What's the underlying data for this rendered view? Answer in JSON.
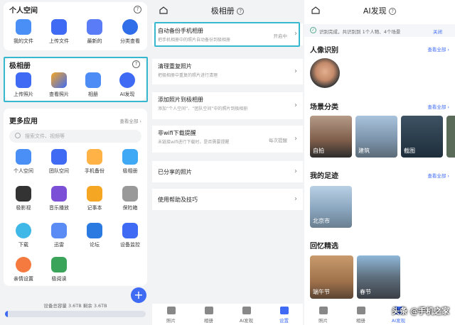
{
  "personal": {
    "title": "个人空间",
    "items": [
      {
        "label": "我的文件",
        "icon": "folder-icon"
      },
      {
        "label": "上传文件",
        "icon": "upload-icon"
      },
      {
        "label": "最新的",
        "icon": "recent-icon"
      },
      {
        "label": "分类查看",
        "icon": "category-icon"
      }
    ]
  },
  "album": {
    "title": "极相册",
    "items": [
      {
        "label": "上传照片",
        "icon": "upload-photo-icon"
      },
      {
        "label": "查看照片",
        "icon": "view-photo-icon"
      },
      {
        "label": "相册",
        "icon": "album-icon"
      },
      {
        "label": "AI发现",
        "icon": "ai-icon"
      }
    ]
  },
  "more": {
    "title": "更多应用",
    "view_all": "查看全部 ›",
    "search_placeholder": "搜索文件、视频等",
    "items": [
      {
        "label": "个人空间",
        "icon": "personal-space-icon"
      },
      {
        "label": "团队空间",
        "icon": "team-space-icon"
      },
      {
        "label": "手机备份",
        "icon": "phone-backup-icon"
      },
      {
        "label": "极相册",
        "icon": "photo-album-icon"
      },
      {
        "label": "极影视",
        "icon": "video-icon"
      },
      {
        "label": "音乐播放",
        "icon": "music-icon"
      },
      {
        "label": "记事本",
        "icon": "notepad-icon"
      },
      {
        "label": "保险箱",
        "icon": "safe-icon"
      },
      {
        "label": "下载",
        "icon": "download-icon"
      },
      {
        "label": "迅雷",
        "icon": "xunlei-icon"
      },
      {
        "label": "论坛",
        "icon": "forum-icon"
      },
      {
        "label": "设备监控",
        "icon": "monitor-icon"
      },
      {
        "label": "亲情设置",
        "icon": "family-icon"
      },
      {
        "label": "极阅读",
        "icon": "reading-icon"
      }
    ]
  },
  "storage": {
    "text": "设备总容量 3.6TB   剩余 3.6TB",
    "fraction": 0.02
  },
  "middle": {
    "title": "极相册",
    "rows": [
      {
        "title": "自动备份手机相册",
        "sub": "把手机相册中的照片自动备份到极相册",
        "value": "开启中"
      },
      {
        "title": "清理重复照片",
        "sub": "把极相册中重复的照片进行清理",
        "value": ""
      },
      {
        "title": "添加照片到极相册",
        "sub": "添加“个人空间”、“团队空间”中的照片到极相册",
        "value": ""
      },
      {
        "title": "非wifi下载提醒",
        "sub": "未链接wifi进行下载时，是否需要提醒",
        "value": "每次提醒"
      },
      {
        "title": "已分享的照片",
        "sub": "",
        "value": ""
      },
      {
        "title": "使用帮助及技巧",
        "sub": "",
        "value": ""
      }
    ],
    "tabs": [
      {
        "label": "照片",
        "icon": "photo-tab-icon"
      },
      {
        "label": "相册",
        "icon": "album-tab-icon"
      },
      {
        "label": "AI发现",
        "icon": "ai-tab-icon"
      },
      {
        "label": "设置",
        "icon": "settings-tab-icon"
      }
    ]
  },
  "right": {
    "title": "AI发现",
    "banner": "识别完成，共识别到 1个人物、4个场景",
    "banner_close": "关闭",
    "portrait": {
      "title": "人像识别",
      "view_all": "查看全部 ›"
    },
    "scene": {
      "title": "场景分类",
      "view_all": "查看全部 ›",
      "items": [
        "自拍",
        "建筑",
        "截图"
      ]
    },
    "footprint": {
      "title": "我的足迹",
      "view_all": "查看全部 ›",
      "items": [
        "北京市"
      ]
    },
    "memories": {
      "title": "回忆精选",
      "items": [
        "端午节",
        "春节"
      ]
    },
    "tabs": [
      {
        "label": "照片",
        "icon": "photo-tab-icon"
      },
      {
        "label": "相册",
        "icon": "album-tab-icon"
      },
      {
        "label": "AI发现",
        "icon": "ai-tab-icon"
      }
    ]
  },
  "watermark": "头条 @手机之家",
  "colors": {
    "accent": "#3f6bf4",
    "highlight": "#36b9cf"
  }
}
